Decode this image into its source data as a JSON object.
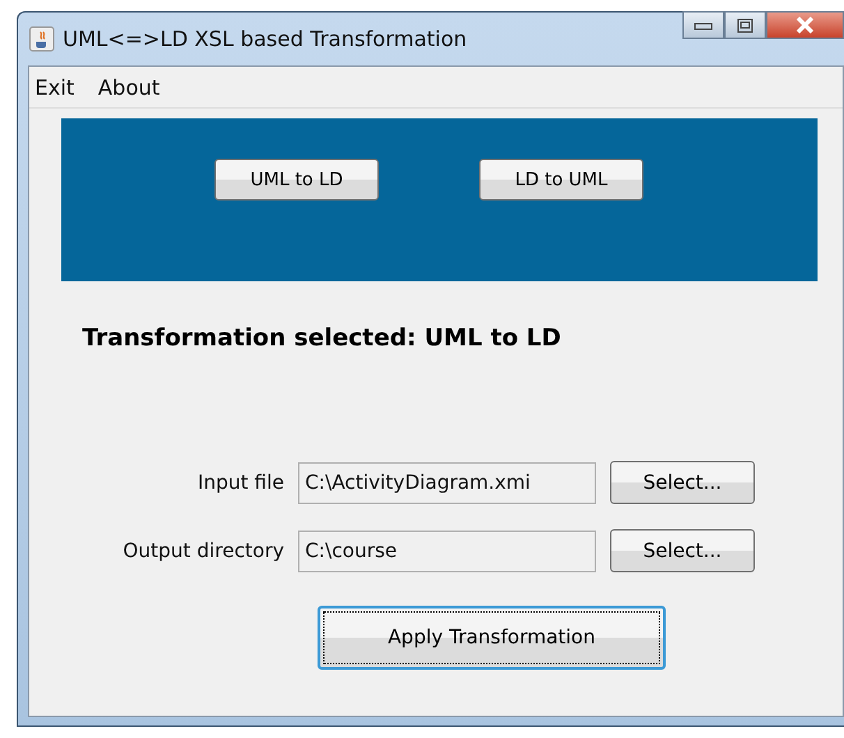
{
  "window": {
    "title": "UML<=>LD  XSL based Transformation"
  },
  "menu": [
    {
      "label": "Exit"
    },
    {
      "label": "About"
    }
  ],
  "mode_buttons": [
    {
      "label": "UML to LD"
    },
    {
      "label": "LD to UML"
    }
  ],
  "status": "Transformation selected:  UML to LD",
  "fields": [
    {
      "label": "Input file",
      "value": "C:\\ActivityDiagram.xmi",
      "button": "Select..."
    },
    {
      "label": "Output directory",
      "value": "C:\\course",
      "button": "Select..."
    }
  ],
  "apply_button": {
    "label": "Apply Transformation",
    "focused": true
  }
}
